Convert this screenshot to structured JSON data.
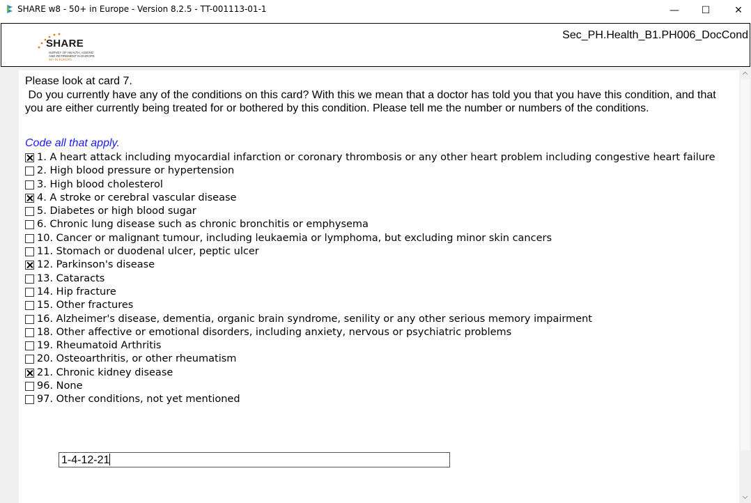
{
  "window": {
    "title": "SHARE w8 - 50+ in Europe - Version 8.2.5 - TT-001113-01-1",
    "minimize": "—",
    "maximize": "☐",
    "close": "✕"
  },
  "header": {
    "logo_word": "SHARE",
    "logo_line1": "SURVEY OF HEALTH, AGEING",
    "logo_line2": "AND RETIREMENT IN EUROPE",
    "logo_line3": "50+ IN EUROPA",
    "section_id": "Sec_PH.Health_B1.PH006_DocCond"
  },
  "question": {
    "line1": "Please look at card 7.",
    "line2": " Do you currently have any of the conditions on this card? With this we mean that a doctor has told you that you have this condition, and that you are either currently being treated for or bothered by this condition. Please tell me the number or numbers of the conditions.",
    "instruction": "Code all that apply."
  },
  "options": [
    {
      "label": "1. A heart attack including myocardial infarction or coronary thrombosis or any other heart problem including congestive heart failure",
      "checked": true
    },
    {
      "label": "2. High blood pressure or hypertension",
      "checked": false
    },
    {
      "label": "3. High blood cholesterol",
      "checked": false
    },
    {
      "label": "4. A stroke or cerebral vascular disease",
      "checked": true
    },
    {
      "label": "5. Diabetes or high blood sugar",
      "checked": false
    },
    {
      "label": "6. Chronic lung disease such as chronic bronchitis or emphysema",
      "checked": false
    },
    {
      "label": "10. Cancer or malignant tumour, including leukaemia or lymphoma, but excluding minor skin cancers",
      "checked": false
    },
    {
      "label": "11. Stomach or duodenal ulcer, peptic ulcer",
      "checked": false
    },
    {
      "label": "12. Parkinson's disease",
      "checked": true
    },
    {
      "label": "13. Cataracts",
      "checked": false
    },
    {
      "label": "14. Hip fracture",
      "checked": false
    },
    {
      "label": "15. Other fractures",
      "checked": false
    },
    {
      "label": "16. Alzheimer's disease, dementia, organic brain syndrome, senility or any other serious memory impairment",
      "checked": false
    },
    {
      "label": "18. Other affective or emotional disorders, including anxiety, nervous or psychiatric problems",
      "checked": false
    },
    {
      "label": "19. Rheumatoid Arthritis",
      "checked": false
    },
    {
      "label": "20. Osteoarthritis, or other rheumatism",
      "checked": false
    },
    {
      "label": "21. Chronic kidney disease",
      "checked": true
    },
    {
      "label": "96. None",
      "checked": false
    },
    {
      "label": "97. Other conditions, not yet mentioned",
      "checked": false
    }
  ],
  "answer": {
    "value": "1-4-12-21"
  },
  "scrollbar": {
    "up_arrow": "^",
    "down_arrow": "v"
  },
  "colors": {
    "instruction": "#1a1aff",
    "logo_accent": "#e07a1a",
    "frame_background": "#f0f0f0"
  }
}
